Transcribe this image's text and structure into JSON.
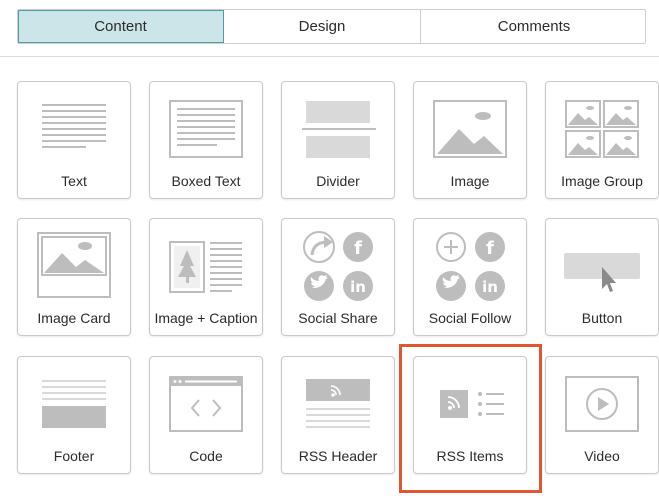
{
  "tabs": [
    "Content",
    "Design",
    "Comments"
  ],
  "active_tab": "Content",
  "blocks": [
    {
      "label": "Text",
      "icon": "text-icon"
    },
    {
      "label": "Boxed Text",
      "icon": "boxed-text-icon"
    },
    {
      "label": "Divider",
      "icon": "divider-icon"
    },
    {
      "label": "Image",
      "icon": "image-icon"
    },
    {
      "label": "Image Group",
      "icon": "image-group-icon"
    },
    {
      "label": "Image Card",
      "icon": "image-card-icon"
    },
    {
      "label": "Image + Caption",
      "icon": "image-caption-icon"
    },
    {
      "label": "Social Share",
      "icon": "social-share-icon"
    },
    {
      "label": "Social Follow",
      "icon": "social-follow-icon"
    },
    {
      "label": "Button",
      "icon": "button-icon"
    },
    {
      "label": "Footer",
      "icon": "footer-icon"
    },
    {
      "label": "Code",
      "icon": "code-icon"
    },
    {
      "label": "RSS Header",
      "icon": "rss-header-icon"
    },
    {
      "label": "RSS Items",
      "icon": "rss-items-icon"
    },
    {
      "label": "Video",
      "icon": "video-icon"
    }
  ],
  "highlighted_block": "RSS Items",
  "colors": {
    "active_tab_bg": "#cce5e8",
    "active_tab_border": "#4e9ca6",
    "icon_gray": "#bdbdbd",
    "highlight": "#e0562f"
  }
}
